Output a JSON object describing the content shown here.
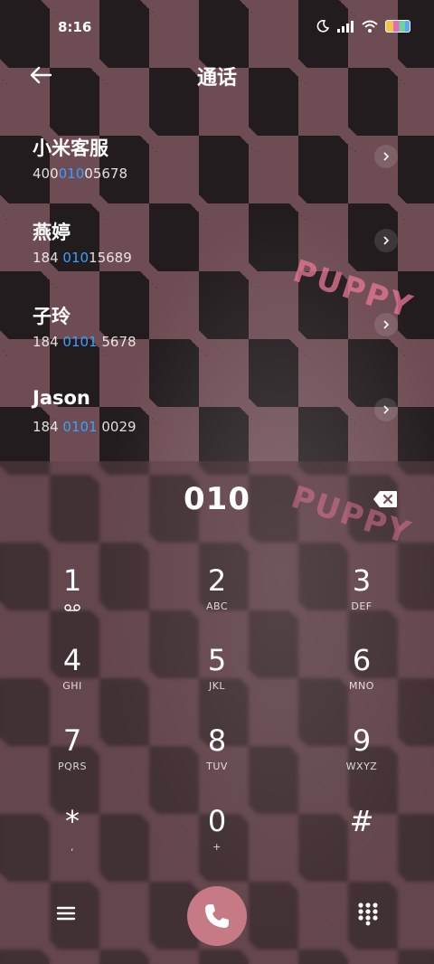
{
  "status": {
    "time": "8:16",
    "icons": [
      "moon-icon",
      "signal-icon",
      "wifi-icon",
      "battery-icon"
    ]
  },
  "header": {
    "title": "通话"
  },
  "contacts": [
    {
      "name": "小米客服",
      "number_pre": "400",
      "number_hl": "010",
      "number_post": "05678"
    },
    {
      "name": "燕婷",
      "number_pre": "184 ",
      "number_hl": "010",
      "number_post": "15689"
    },
    {
      "name": "子玲",
      "number_pre": "184 ",
      "number_hl": "0101",
      "number_post": " 5678"
    },
    {
      "name": "Jason",
      "number_pre": "184 ",
      "number_hl": "0101",
      "number_post": " 0029"
    }
  ],
  "dialpad": {
    "input": "010",
    "keys": [
      {
        "digit": "1",
        "letters": ""
      },
      {
        "digit": "2",
        "letters": "ABC"
      },
      {
        "digit": "3",
        "letters": "DEF"
      },
      {
        "digit": "4",
        "letters": "GHI"
      },
      {
        "digit": "5",
        "letters": "JKL"
      },
      {
        "digit": "6",
        "letters": "MNO"
      },
      {
        "digit": "7",
        "letters": "PQRS"
      },
      {
        "digit": "8",
        "letters": "TUV"
      },
      {
        "digit": "9",
        "letters": "WXYZ"
      },
      {
        "digit": "*",
        "letters": ","
      },
      {
        "digit": "0",
        "letters": "+"
      },
      {
        "digit": "#",
        "letters": ""
      }
    ]
  },
  "wallpaper": {
    "tag_text": "PUPPY"
  },
  "colors": {
    "highlight": "#3aa0ff",
    "call_button": "#c57a86"
  }
}
